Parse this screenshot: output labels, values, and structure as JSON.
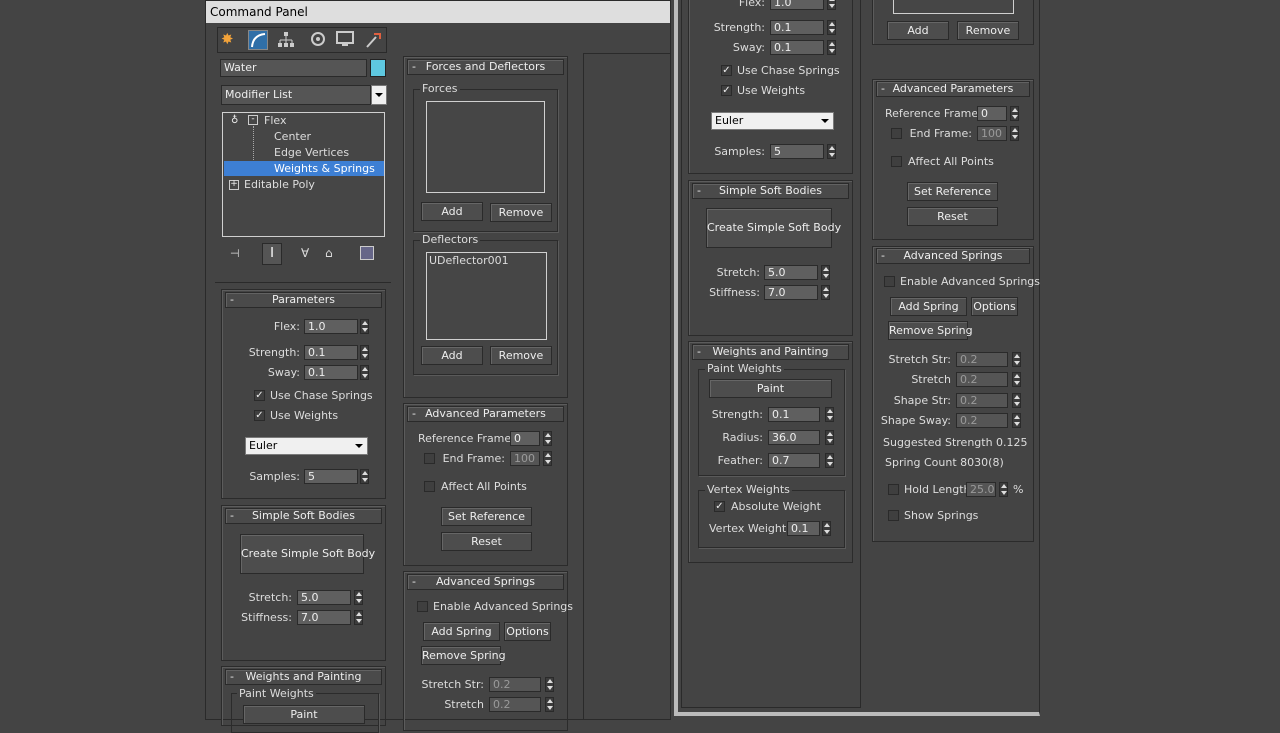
{
  "window": {
    "title": "Command Panel"
  },
  "object": {
    "name": "Water",
    "color": "#5ec8e0"
  },
  "modifier_list": {
    "label": "Modifier List"
  },
  "stack": [
    {
      "label": "Flex"
    },
    {
      "label": "Center"
    },
    {
      "label": "Edge Vertices"
    },
    {
      "label": "Weights & Springs"
    },
    {
      "label": "Editable Poly"
    }
  ],
  "rollouts": {
    "parameters": "Parameters",
    "simple_soft_bodies": "Simple Soft Bodies",
    "weights_painting": "Weights and Painting",
    "forces_deflectors": "Forces and Deflectors",
    "advanced_parameters": "Advanced Parameters",
    "advanced_springs": "Advanced Springs"
  },
  "params": {
    "flex_label": "Flex:",
    "flex": "1.0",
    "strength_label": "Strength:",
    "strength": "0.1",
    "sway_label": "Sway:",
    "sway": "0.1",
    "chase": "Use Chase Springs",
    "weights": "Use Weights",
    "solver": "Euler",
    "samples_label": "Samples:",
    "samples": "5"
  },
  "ssb": {
    "create": "Create Simple Soft Body",
    "stretch_label": "Stretch:",
    "stretch": "5.0",
    "stiffness_label": "Stiffness:",
    "stiffness": "7.0"
  },
  "wp": {
    "paint_weights": "Paint Weights",
    "paint": "Paint",
    "strength_label": "Strength:",
    "strength": "0.1",
    "radius_label": "Radius:",
    "radius": "36.0",
    "feather_label": "Feather:",
    "feather": "0.7",
    "vertex_weights": "Vertex Weights",
    "absolute": "Absolute Weight",
    "vw_label": "Vertex Weight:",
    "vw": "0.1"
  },
  "fd": {
    "forces": "Forces",
    "deflectors": "Deflectors",
    "deflector_item": "UDeflector001",
    "add": "Add",
    "remove": "Remove"
  },
  "ap": {
    "ref_label": "Reference Frame:",
    "ref": "0",
    "end_label": "End Frame:",
    "end": "100",
    "affect": "Affect All Points",
    "set_ref": "Set Reference",
    "reset": "Reset"
  },
  "as": {
    "enable": "Enable Advanced Springs",
    "add_spring": "Add Spring",
    "options": "Options",
    "remove_spring": "Remove Spring",
    "stretch_str_label": "Stretch Str:",
    "stretch_str": "0.2",
    "stretch_label": "Stretch",
    "stretch": "0.2",
    "shape_str_label": "Shape Str:",
    "shape_str": "0.2",
    "shape_sway_label": "Shape Sway:",
    "shape_sway": "0.2",
    "suggested": "Suggested Strength 0.125",
    "count": "Spring Count 8030(8)",
    "hold": "Hold Length",
    "hold_val": "25.0",
    "pct": "%",
    "show": "Show Springs"
  }
}
